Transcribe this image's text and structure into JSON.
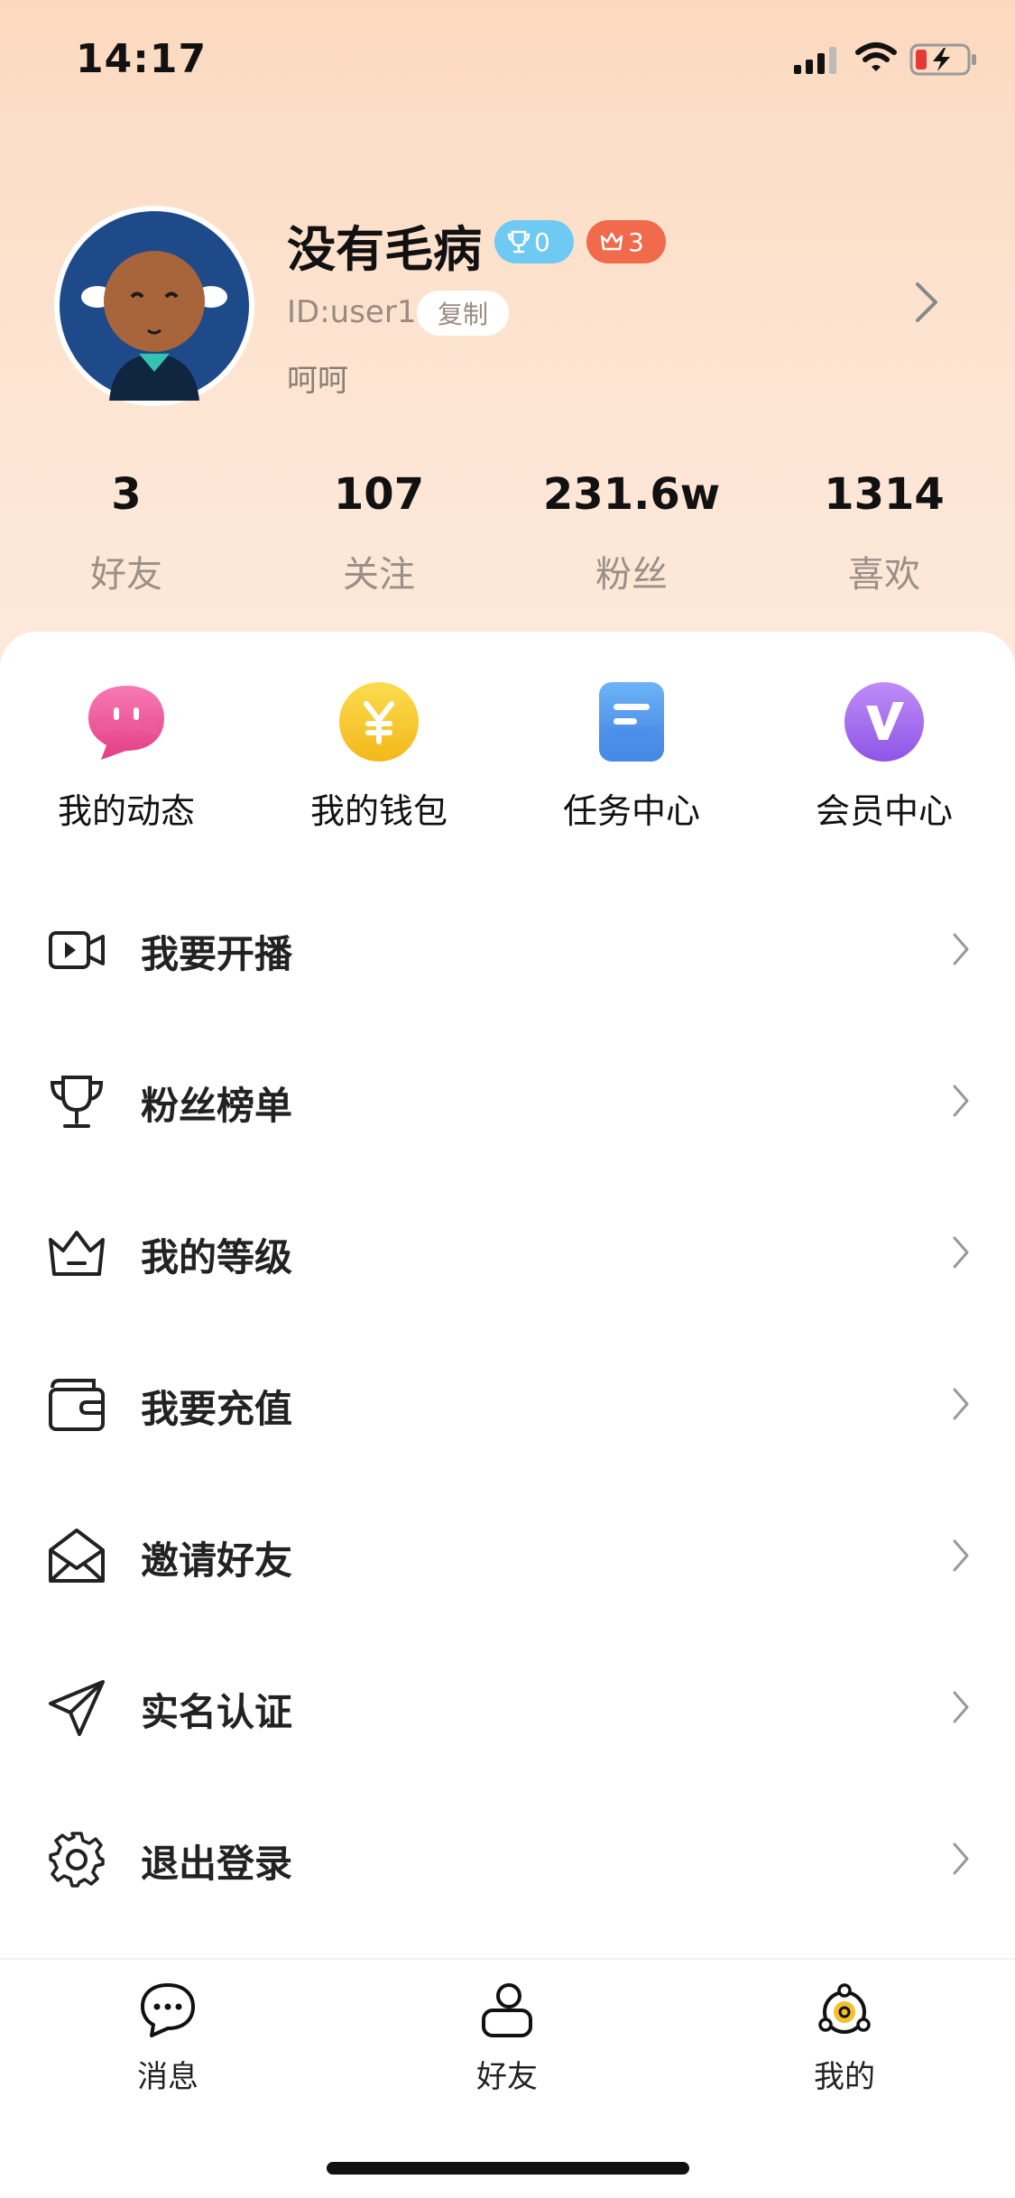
{
  "status_bar": {
    "time": "14:17"
  },
  "profile": {
    "name": "没有毛病",
    "trophy_count": "0",
    "crown_count": "3",
    "user_id": "ID:user1",
    "copy_label": "复制",
    "bio": "呵呵"
  },
  "stats": [
    {
      "value": "3",
      "label": "好友"
    },
    {
      "value": "107",
      "label": "关注"
    },
    {
      "value": "231.6w",
      "label": "粉丝"
    },
    {
      "value": "1314",
      "label": "喜欢"
    }
  ],
  "quick_actions": [
    {
      "label": "我的动态",
      "icon": "chat-bubble-icon"
    },
    {
      "label": "我的钱包",
      "icon": "yen-coin-icon"
    },
    {
      "label": "任务中心",
      "icon": "task-list-icon"
    },
    {
      "label": "会员中心",
      "icon": "vip-v-icon"
    }
  ],
  "menu": [
    {
      "label": "我要开播",
      "icon": "video-camera-icon"
    },
    {
      "label": "粉丝榜单",
      "icon": "trophy-icon"
    },
    {
      "label": "我的等级",
      "icon": "crown-icon"
    },
    {
      "label": "我要充值",
      "icon": "wallet-icon"
    },
    {
      "label": "邀请好友",
      "icon": "envelope-icon"
    },
    {
      "label": "实名认证",
      "icon": "paper-plane-icon"
    },
    {
      "label": "退出登录",
      "icon": "gear-icon"
    }
  ],
  "tabs": [
    {
      "label": "消息",
      "icon": "message-icon",
      "active": false
    },
    {
      "label": "好友",
      "icon": "person-icon",
      "active": false
    },
    {
      "label": "我的",
      "icon": "me-icon",
      "active": true
    }
  ],
  "colors": {
    "trophy_badge": "#6ec9f3",
    "crown_badge": "#f06a4b",
    "accent": "#f5c02e"
  }
}
